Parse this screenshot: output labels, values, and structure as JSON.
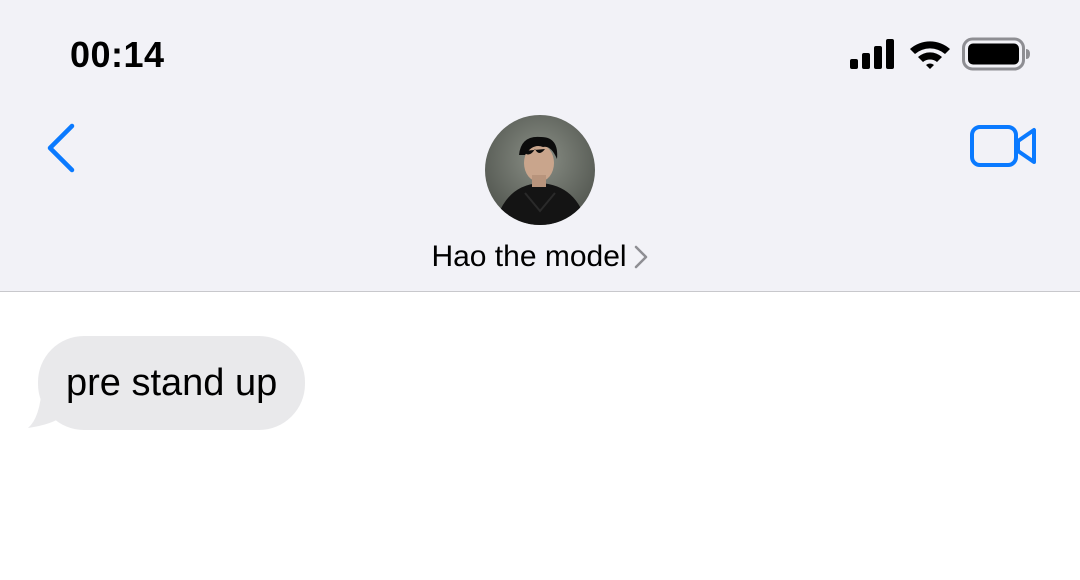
{
  "status_bar": {
    "time": "00:14",
    "icons": [
      "cellular-signal-icon",
      "wifi-icon",
      "battery-icon"
    ]
  },
  "nav": {
    "back_icon": "chevron-left-icon",
    "video_icon": "video-camera-icon",
    "accent_color": "#0a7aff"
  },
  "contact": {
    "name": "Hao the model",
    "avatar": "contact-photo"
  },
  "messages": [
    {
      "direction": "incoming",
      "text": "pre stand up"
    }
  ],
  "colors": {
    "header_bg": "#f2f2f7",
    "incoming_bubble": "#e9e9eb",
    "accent": "#0a7aff"
  }
}
